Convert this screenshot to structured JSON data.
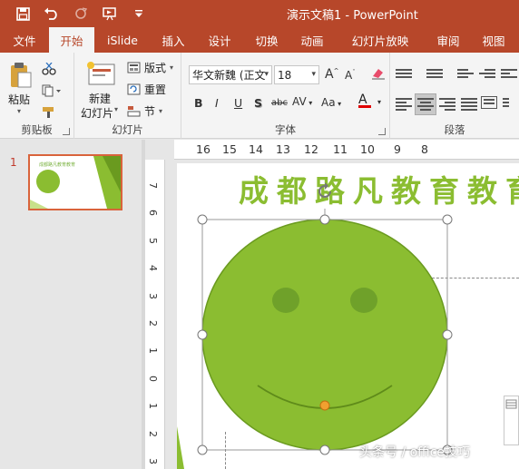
{
  "titlebar": {
    "title": "演示文稿1  -  PowerPoint",
    "qat": [
      "save-icon",
      "undo-icon",
      "redo-icon",
      "slideshow-from-start-icon",
      "customize-qat-icon"
    ]
  },
  "tabs": [
    {
      "label": "文件"
    },
    {
      "label": "开始"
    },
    {
      "label": "iSlide"
    },
    {
      "label": "插入"
    },
    {
      "label": "设计"
    },
    {
      "label": "切换"
    },
    {
      "label": "动画"
    },
    {
      "label": "幻灯片放映"
    },
    {
      "label": "审阅"
    },
    {
      "label": "视图"
    }
  ],
  "ribbon": {
    "clipboard": {
      "label": "剪贴板",
      "paste": "粘贴"
    },
    "slides": {
      "label": "幻灯片",
      "new_slide_line1": "新建",
      "new_slide_line2": "幻灯片",
      "layout": "版式",
      "reset": "重置",
      "section": "节"
    },
    "font": {
      "label": "字体",
      "font_name": "华文新魏 (正文",
      "font_size": "18",
      "bold": "B",
      "italic": "I",
      "underline": "U",
      "shadow": "S",
      "strike": "abc",
      "spacing": "AV",
      "case": "Aa",
      "color_letter": "A",
      "grow": "A",
      "shrink": "A"
    },
    "paragraph": {
      "label": "段落"
    }
  },
  "thumbnails": {
    "slide_number": "1",
    "thumb_title": "成都路凡教育教育"
  },
  "ruler": {
    "h_ticks": [
      "16",
      "15",
      "14",
      "13",
      "12",
      "11",
      "10",
      "9",
      "8"
    ],
    "v_ticks": [
      "7",
      "6",
      "5",
      "4",
      "3",
      "2",
      "1",
      "0",
      "1",
      "2",
      "3"
    ]
  },
  "slide": {
    "title": "成都路凡教育教育"
  },
  "watermark": "头条号 / office技巧",
  "colors": {
    "accent": "#b7472a",
    "smiley_fill": "#8bbd31",
    "smiley_stroke": "#6a9a1f",
    "eye": "#6fa12a",
    "handle_adjust": "#f0a030"
  }
}
